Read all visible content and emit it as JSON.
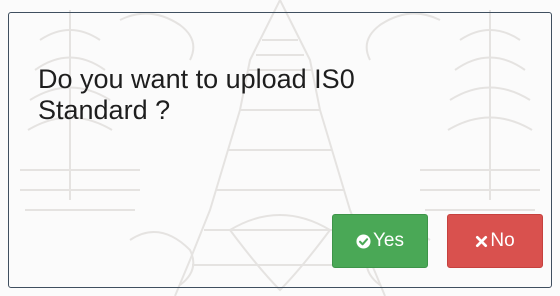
{
  "dialog": {
    "message": "Do you want to upload IS0\nStandard ?",
    "buttons": {
      "yes_label": "Yes",
      "no_label": "No"
    },
    "icons": {
      "yes": "check-circle-icon",
      "no": "x-icon"
    },
    "colors": {
      "yes": "#4aa856",
      "no": "#d9514e",
      "border": "#3f4f5f"
    }
  }
}
